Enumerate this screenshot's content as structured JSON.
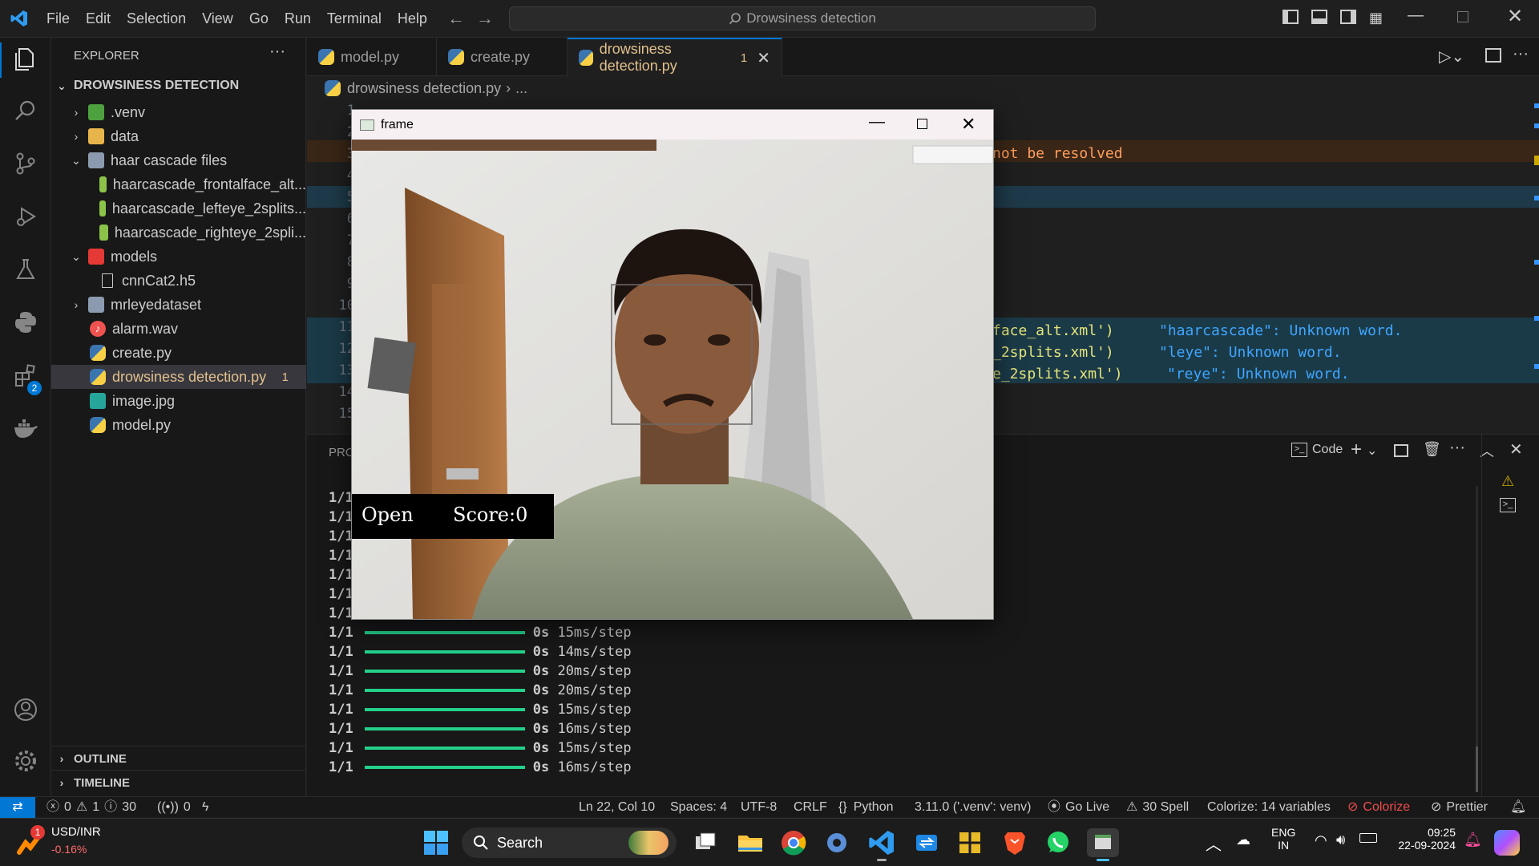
{
  "menu": [
    "File",
    "Edit",
    "Selection",
    "View",
    "Go",
    "Run",
    "Terminal",
    "Help"
  ],
  "command_center": "Drowsiness detection",
  "sidebar": {
    "title": "EXPLORER",
    "section": "DROWSINESS DETECTION",
    "items": [
      {
        "label": ".venv",
        "type": "folder"
      },
      {
        "label": "data",
        "type": "folder"
      },
      {
        "label": "haar cascade files",
        "type": "folder-open"
      },
      {
        "label": "haarcascade_frontalface_alt...",
        "type": "xml"
      },
      {
        "label": "haarcascade_lefteye_2splits...",
        "type": "xml"
      },
      {
        "label": "haarcascade_righteye_2spli...",
        "type": "xml"
      },
      {
        "label": "models",
        "type": "folder-open"
      },
      {
        "label": "cnnCat2.h5",
        "type": "file"
      },
      {
        "label": "mrleyedataset",
        "type": "folder"
      },
      {
        "label": "alarm.wav",
        "type": "audio"
      },
      {
        "label": "create.py",
        "type": "python"
      },
      {
        "label": "drowsiness detection.py",
        "type": "python",
        "badge": "1"
      },
      {
        "label": "image.jpg",
        "type": "image"
      },
      {
        "label": "model.py",
        "type": "python"
      }
    ],
    "outline": "OUTLINE",
    "timeline": "TIMELINE"
  },
  "tabs": [
    {
      "label": "model.py"
    },
    {
      "label": "create.py"
    },
    {
      "label": "drowsiness detection.py",
      "badge": "1"
    }
  ],
  "breadcrumb": {
    "file": "drowsiness detection.py",
    "rest": "..."
  },
  "editor": {
    "line_numbers": [
      "1",
      "2",
      "3",
      "4",
      "5",
      "6",
      "7",
      "8",
      "9",
      "10",
      "11",
      "12",
      "13",
      "14",
      "15"
    ],
    "warning_text": "not be resolved",
    "lines_right": [
      {
        "code": "face_alt.xml')",
        "hint": "\"haarcascade\": Unknown word."
      },
      {
        "code": "_2splits.xml')",
        "hint": "\"leye\": Unknown word."
      },
      {
        "code": "e_2splits.xml')",
        "hint": "\"reye\": Unknown word."
      }
    ]
  },
  "panel": {
    "tab_label": "PRO",
    "terminal_label": "Code",
    "progress_rows": [
      {
        "step": "1/1",
        "time": "",
        "rate": ""
      },
      {
        "step": "1/1",
        "time": "",
        "rate": ""
      },
      {
        "step": "1/1",
        "time": "",
        "rate": ""
      },
      {
        "step": "1/1",
        "time": "",
        "rate": ""
      },
      {
        "step": "1/1",
        "time": "",
        "rate": ""
      },
      {
        "step": "1/1",
        "time": "",
        "rate": ""
      },
      {
        "step": "1/1",
        "time": "",
        "rate": ""
      },
      {
        "step": "1/1",
        "time": "0s",
        "rate": "15ms/step"
      },
      {
        "step": "1/1",
        "time": "0s",
        "rate": "14ms/step"
      },
      {
        "step": "1/1",
        "time": "0s",
        "rate": "20ms/step"
      },
      {
        "step": "1/1",
        "time": "0s",
        "rate": "20ms/step"
      },
      {
        "step": "1/1",
        "time": "0s",
        "rate": "15ms/step"
      },
      {
        "step": "1/1",
        "time": "0s",
        "rate": "16ms/step"
      },
      {
        "step": "1/1",
        "time": "0s",
        "rate": "15ms/step"
      },
      {
        "step": "1/1",
        "time": "0s",
        "rate": "16ms/step"
      }
    ]
  },
  "statusbar": {
    "errors": "0",
    "warnings": "1",
    "infos": "30",
    "ports": "0",
    "position": "Ln 22, Col 10",
    "spaces": "Spaces: 4",
    "encoding": "UTF-8",
    "eol": "CRLF",
    "language": "Python",
    "interpreter": "3.11.0 ('.venv': venv)",
    "golive": "Go Live",
    "spell": "30 Spell",
    "colorize_vars": "Colorize: 14 variables",
    "colorize": "Colorize",
    "prettier": "Prettier"
  },
  "frame_window": {
    "title": "frame",
    "overlay_status": "Open",
    "overlay_score": "Score:0"
  },
  "taskbar": {
    "ticker_name": "USD/INR",
    "ticker_change": "-0.16%",
    "ticker_badge": "1",
    "search": "Search",
    "lang_top": "ENG",
    "lang_bottom": "IN",
    "time": "09:25",
    "date": "22-09-2024"
  },
  "colors": {
    "accent": "#0078d4",
    "modified_file": "#e2c08d",
    "progress": "#23d18b",
    "colorize_red": "#f14c4c"
  }
}
